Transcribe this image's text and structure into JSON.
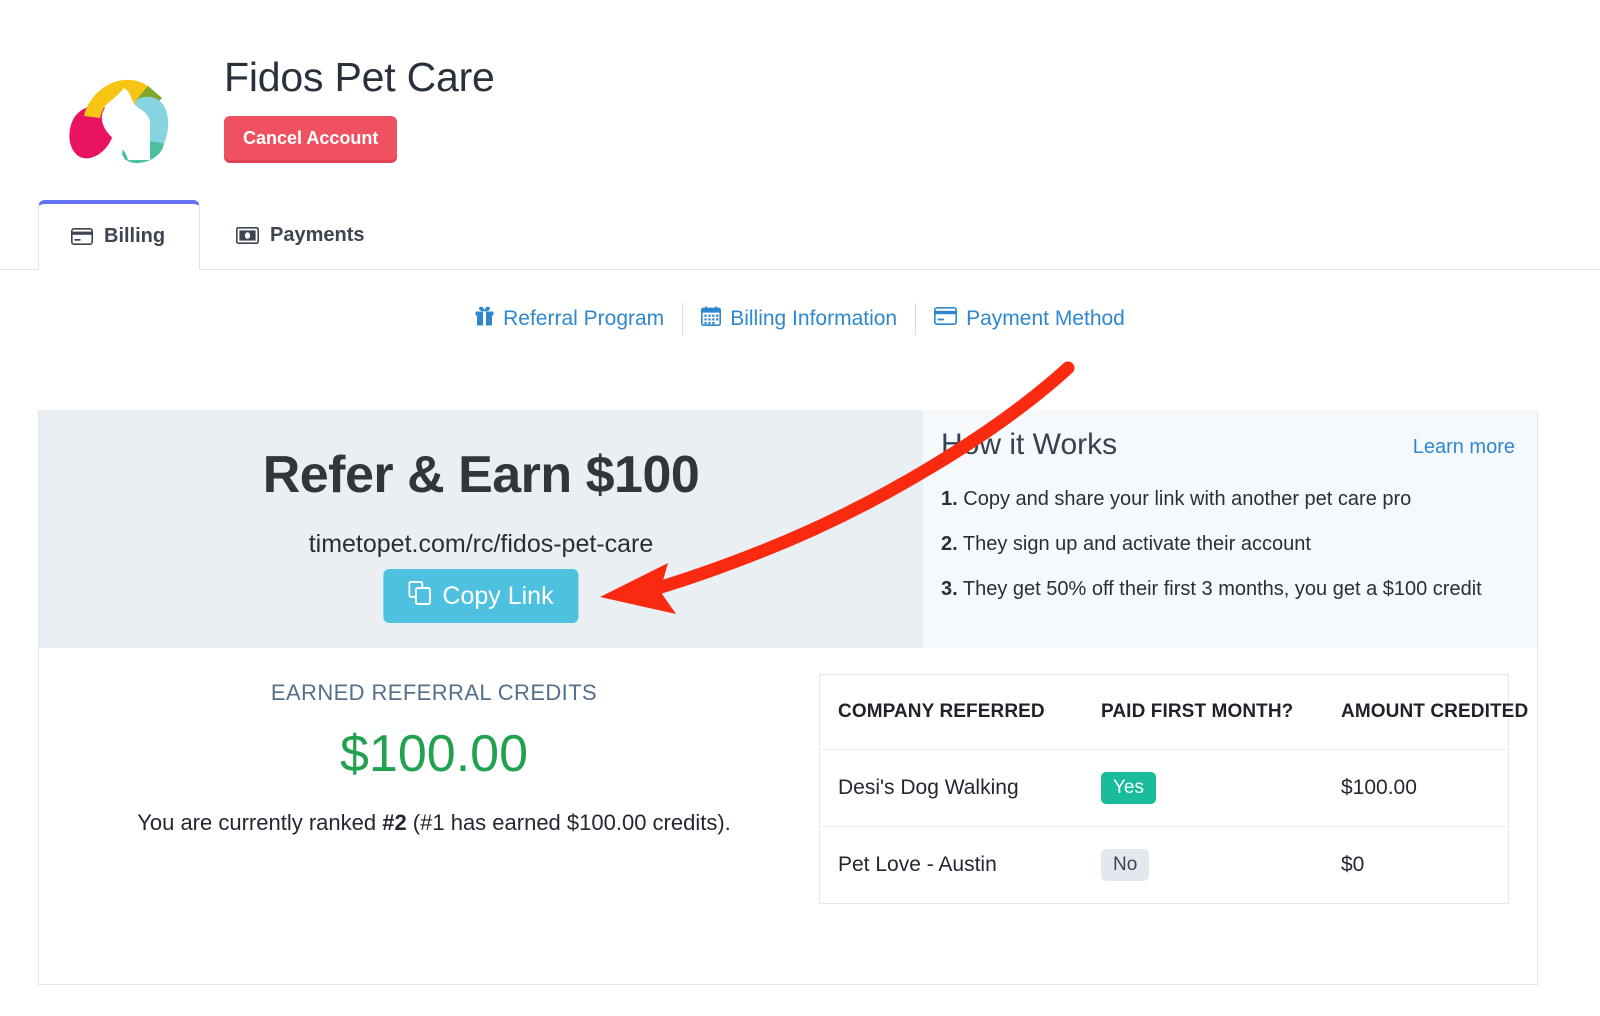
{
  "header": {
    "company_name": "Fidos Pet Care",
    "cancel_button": "Cancel Account",
    "logo_icon": "pet-care-arc-logo"
  },
  "tabs": [
    {
      "label": "Billing",
      "icon": "credit-card-icon",
      "active": true
    },
    {
      "label": "Payments",
      "icon": "banknote-icon",
      "active": false
    }
  ],
  "subnav": [
    {
      "label": "Referral Program",
      "icon": "gift-icon"
    },
    {
      "label": "Billing Information",
      "icon": "calendar-icon"
    },
    {
      "label": "Payment Method",
      "icon": "credit-card-icon"
    }
  ],
  "banner": {
    "headline": "Refer & Earn $100",
    "referral_url": "timetopet.com/rc/fidos-pet-care",
    "copy_button": "Copy Link",
    "copy_icon": "copy-icon"
  },
  "how_it_works": {
    "title": "How it Works",
    "learn_more": "Learn more",
    "steps": [
      {
        "num": "1.",
        "text": "Copy and share your link with another pet care pro"
      },
      {
        "num": "2.",
        "text": "They sign up and activate their account"
      },
      {
        "num": "3.",
        "text": "They get 50% off their first 3 months, you get a $100 credit"
      }
    ]
  },
  "credits": {
    "label": "EARNED REFERRAL CREDITS",
    "amount": "$100.00",
    "rank_prefix": "You are currently ranked ",
    "rank_value": "#2",
    "rank_suffix": " (#1 has earned $100.00 credits)."
  },
  "referral_table": {
    "columns": [
      "COMPANY REFERRED",
      "PAID FIRST MONTH?",
      "AMOUNT CREDITED"
    ],
    "rows": [
      {
        "company": "Desi's Dog Walking",
        "paid": "Yes",
        "paid_state": "yes",
        "amount": "$100.00"
      },
      {
        "company": "Pet Love - Austin",
        "paid": "No",
        "paid_state": "no",
        "amount": "$0"
      }
    ]
  },
  "annotation": {
    "arrow_color": "#fa2a10",
    "points_to": "copy-link-button"
  },
  "colors": {
    "accent_blue": "#2f87cd",
    "tab_active": "#6172f3",
    "danger": "#ef5160",
    "copy_button": "#4fc1e0",
    "credit_green": "#22a24f",
    "badge_yes": "#1abc9c",
    "badge_no": "#e3e8ef"
  }
}
